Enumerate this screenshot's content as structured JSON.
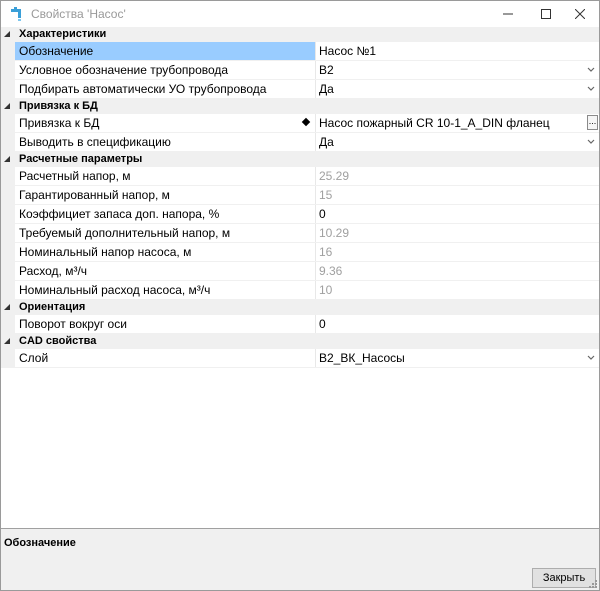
{
  "window": {
    "title": "Свойства 'Насос'",
    "icon": "faucet-icon"
  },
  "categories": {
    "characteristics": {
      "label": "Характеристики",
      "rows": [
        {
          "name": "Обозначение",
          "value": "Насос №1"
        },
        {
          "name": "Условное обозначение трубопровода",
          "value": "В2"
        },
        {
          "name": "Подбирать автоматически УО трубопровода",
          "value": "Да"
        }
      ]
    },
    "db_binding": {
      "label": "Привязка к БД",
      "rows": [
        {
          "name": "Привязка к БД",
          "value": "Насос пожарный CR 10-1_A_DIN фланец"
        },
        {
          "name": "Выводить в спецификацию",
          "value": "Да"
        }
      ]
    },
    "calc": {
      "label": "Расчетные параметры",
      "rows": [
        {
          "name": "Расчетный напор, м",
          "value": "25.29"
        },
        {
          "name": "Гарантированный напор, м",
          "value": "15"
        },
        {
          "name": "Коэффициет запаса доп. напора, %",
          "value": "0"
        },
        {
          "name": "Требуемый дополнительный напор, м",
          "value": "10.29"
        },
        {
          "name": "Номинальный напор насоса, м",
          "value": "16"
        },
        {
          "name": "Расход, м³/ч",
          "value": "9.36"
        },
        {
          "name": "Номинальный расход насоса, м³/ч",
          "value": "10"
        }
      ]
    },
    "orientation": {
      "label": "Ориентация",
      "rows": [
        {
          "name": "Поворот вокруг оси",
          "value": "0"
        }
      ]
    },
    "cad": {
      "label": "CAD свойства",
      "rows": [
        {
          "name": "Слой",
          "value": "В2_ВК_Насосы"
        }
      ]
    }
  },
  "ellipsis": "...",
  "description": {
    "title": "Обозначение"
  },
  "footer": {
    "close_label": "Закрыть"
  }
}
